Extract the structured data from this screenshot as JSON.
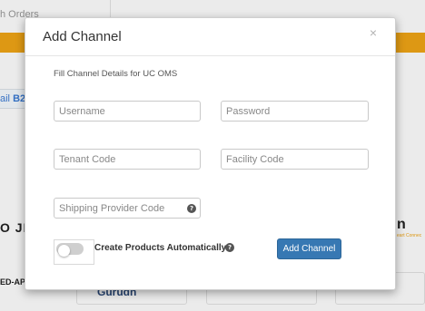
{
  "background": {
    "tab_label": "h Orders",
    "chip_text_prefix": "ail ",
    "chip_text_bold": "B2",
    "left_logo_text": "O JI",
    "left_bottom_text": "ED-AP",
    "middle_card_text": "Gurudh",
    "right_logo_text": "n",
    "right_logo_sub": "eart Connec"
  },
  "modal": {
    "title": "Add Channel",
    "close_glyph": "×",
    "subtitle": "Fill Channel Details for UC OMS",
    "fields": {
      "username": {
        "placeholder": "Username",
        "value": ""
      },
      "password": {
        "placeholder": "Password",
        "value": ""
      },
      "tenant_code": {
        "placeholder": "Tenant Code",
        "value": ""
      },
      "facility_code": {
        "placeholder": "Facility Code",
        "value": ""
      },
      "shipping_provider_code": {
        "placeholder": "Shipping Provider Code",
        "value": ""
      }
    },
    "help_glyph": "?",
    "create_products_label": "Create Products Automatically",
    "create_products_enabled": false,
    "add_button_label": "Add Channel"
  },
  "colors": {
    "primary_button": "#3778b3",
    "accent_bar": "#f0a516",
    "toggle_off": "#cfcfcf"
  }
}
